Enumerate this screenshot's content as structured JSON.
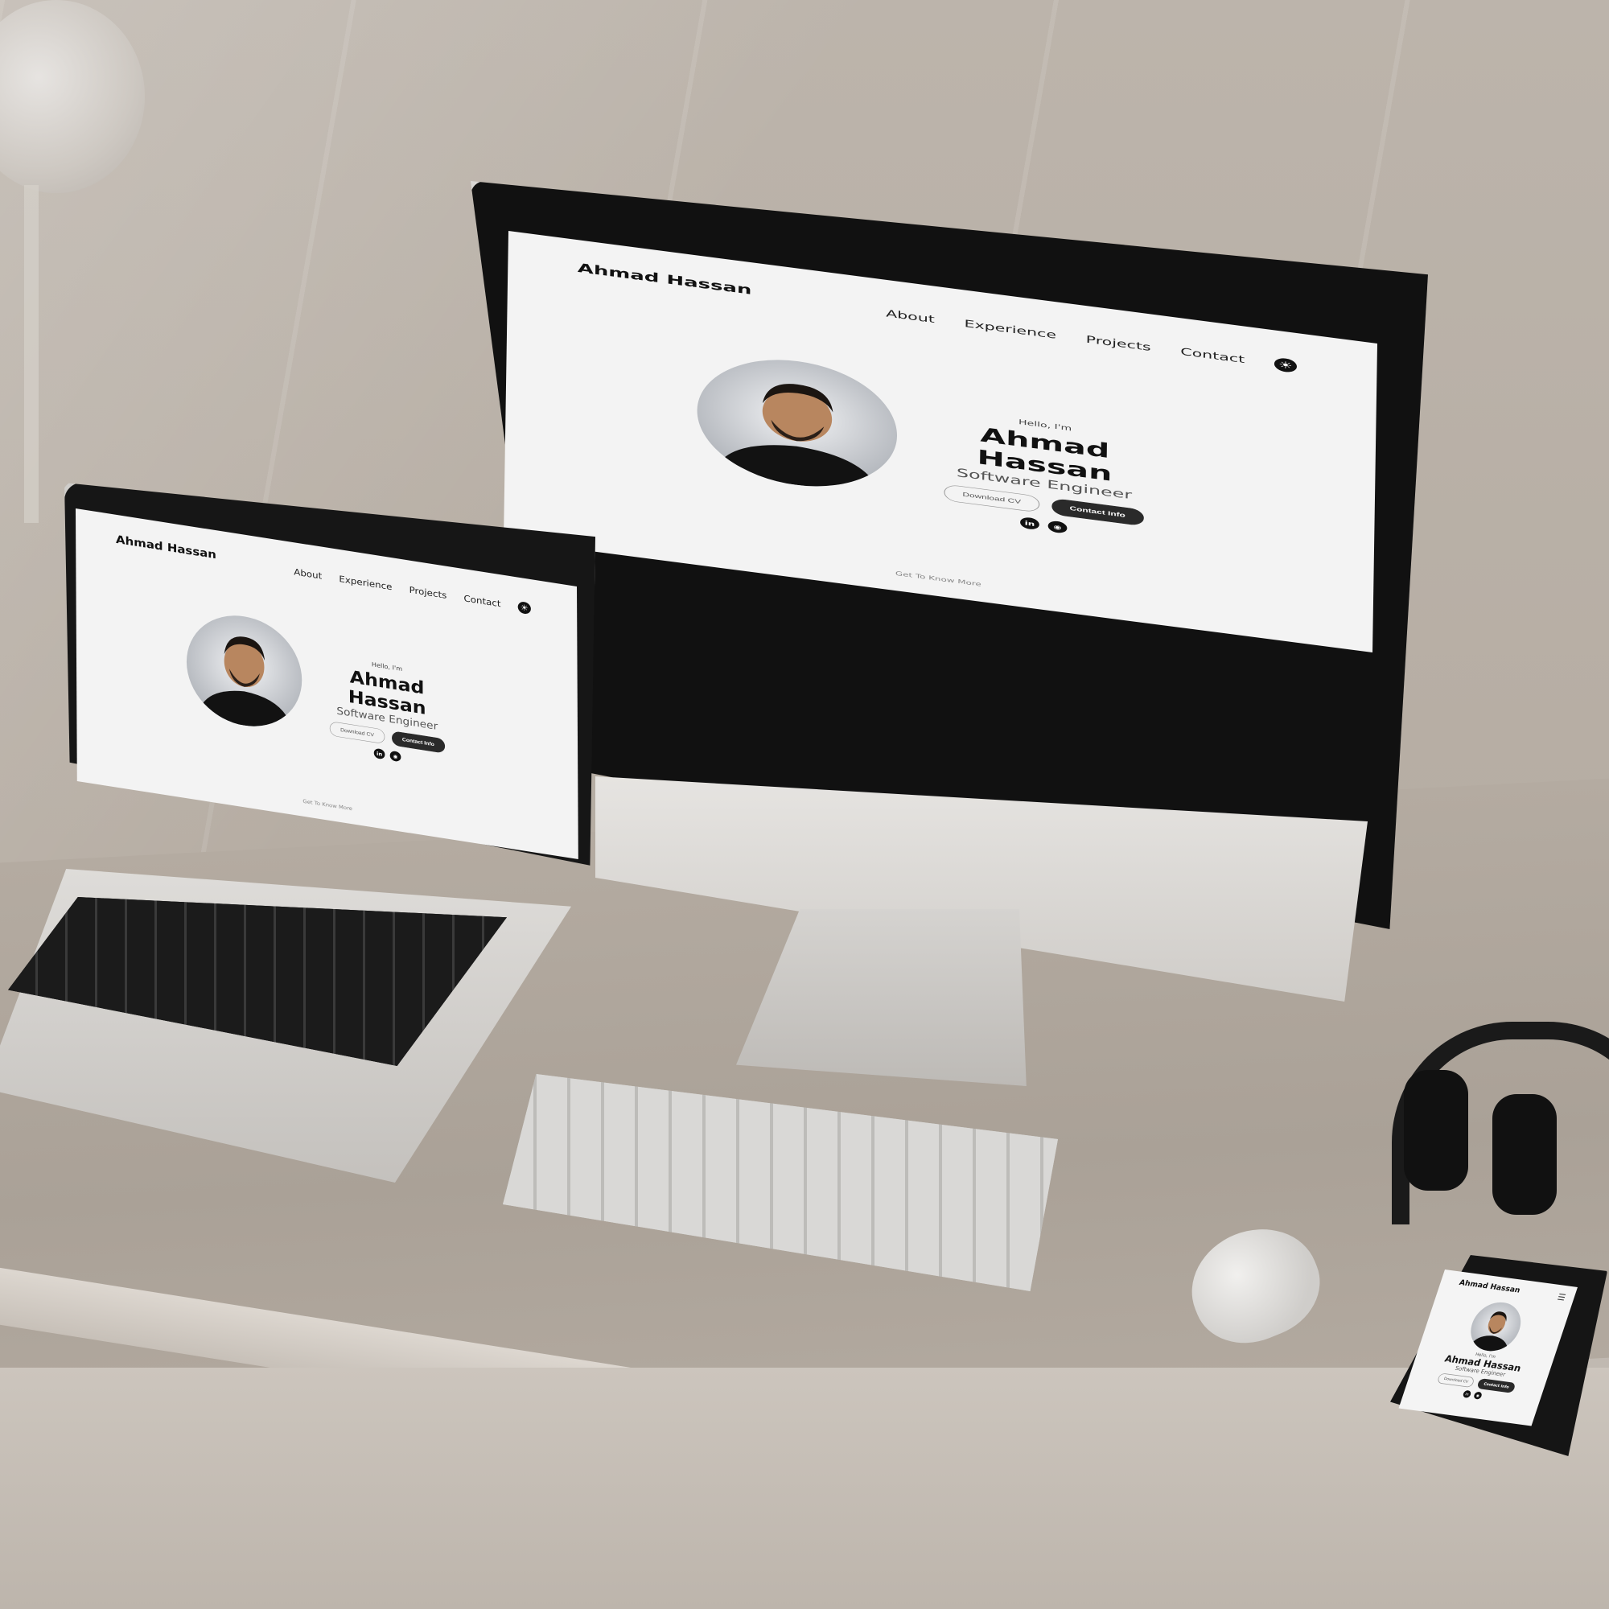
{
  "site": {
    "brand": "Ahmad Hassan",
    "nav": [
      "About",
      "Experience",
      "Projects",
      "Contact"
    ],
    "theme_toggle_icon": "sun-icon",
    "hero": {
      "greeting": "Hello, I'm",
      "name": "Ahmad Hassan",
      "role": "Software Engineer",
      "download_cv": "Download CV",
      "contact_info": "Contact Info",
      "socials": [
        {
          "name": "linkedin-icon",
          "glyph": "in"
        },
        {
          "name": "github-icon",
          "glyph": "◉"
        }
      ]
    },
    "scroll_hint": "Get To Know More"
  },
  "colors": {
    "background": "#f3f3f3",
    "text": "#111111",
    "muted": "#555555",
    "button_dark": "#2a2a2a"
  }
}
